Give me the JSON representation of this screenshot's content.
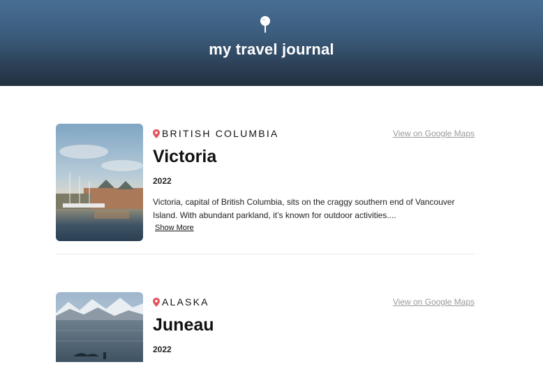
{
  "header": {
    "logo_icon": "map-pin-icon",
    "title": "my travel journal"
  },
  "colors": {
    "header_top": "#476f95",
    "header_bottom": "#22313f",
    "pin_red": "#e4545e",
    "link_gray": "#9a9a9a"
  },
  "entries": [
    {
      "location": "BRITISH COLUMBIA",
      "location_icon": "location-pin-icon",
      "maps_link": "View on Google Maps",
      "title": "Victoria",
      "year": "2022",
      "description": "Victoria, capital of British Columbia, sits on the craggy southern end of Vancouver Island. With abundant parkland, it’s known for outdoor activities....",
      "show_more": "Show More"
    },
    {
      "location": "ALASKA",
      "location_icon": "location-pin-icon",
      "maps_link": "View on Google Maps",
      "title": "Juneau",
      "year": "2022"
    }
  ]
}
